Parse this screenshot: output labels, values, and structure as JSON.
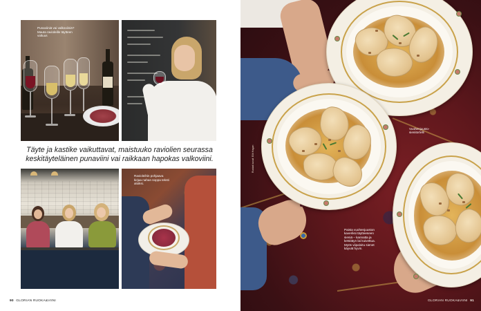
{
  "left_page": {
    "caption_top_left": "Punaviiniä vai valkoviiniä? Mau­ta ravioleille täytteen valtuus",
    "caption_bottom_right": "Ravioleihin pohjaava kirjaa nahan soppa teksti aloiksi.",
    "pull_quote": "Täyte ja kastike vaikuttavat, maistuuko raviolien seurassa keskitäyteläinen punaviini vai raikkaan hapokas valkoviini.",
    "folio_number": "90",
    "folio_title": "GLORIAN RUOKA&VIINI"
  },
  "right_page": {
    "caption_middle": "Vuohenjuusto-sienitortelli",
    "caption_bottom": "Paista vuohenjuuston kaveriksi täytteeseen sieniä – kannatta ja ketsitäyn lai kuivettua. Myös viipaloitu sienet käyvät hyvin.",
    "photo_credit": "Ruokat kuvat: Eilit Hagan",
    "folio_number": "91",
    "folio_title": "GLORIAN RUOKA&VIINI"
  },
  "colors": {
    "rug_red": "#5e171c",
    "plate_cream": "#f4efe4",
    "rim_gold": "#c9a24a",
    "text_dark": "#1c1c1c"
  }
}
